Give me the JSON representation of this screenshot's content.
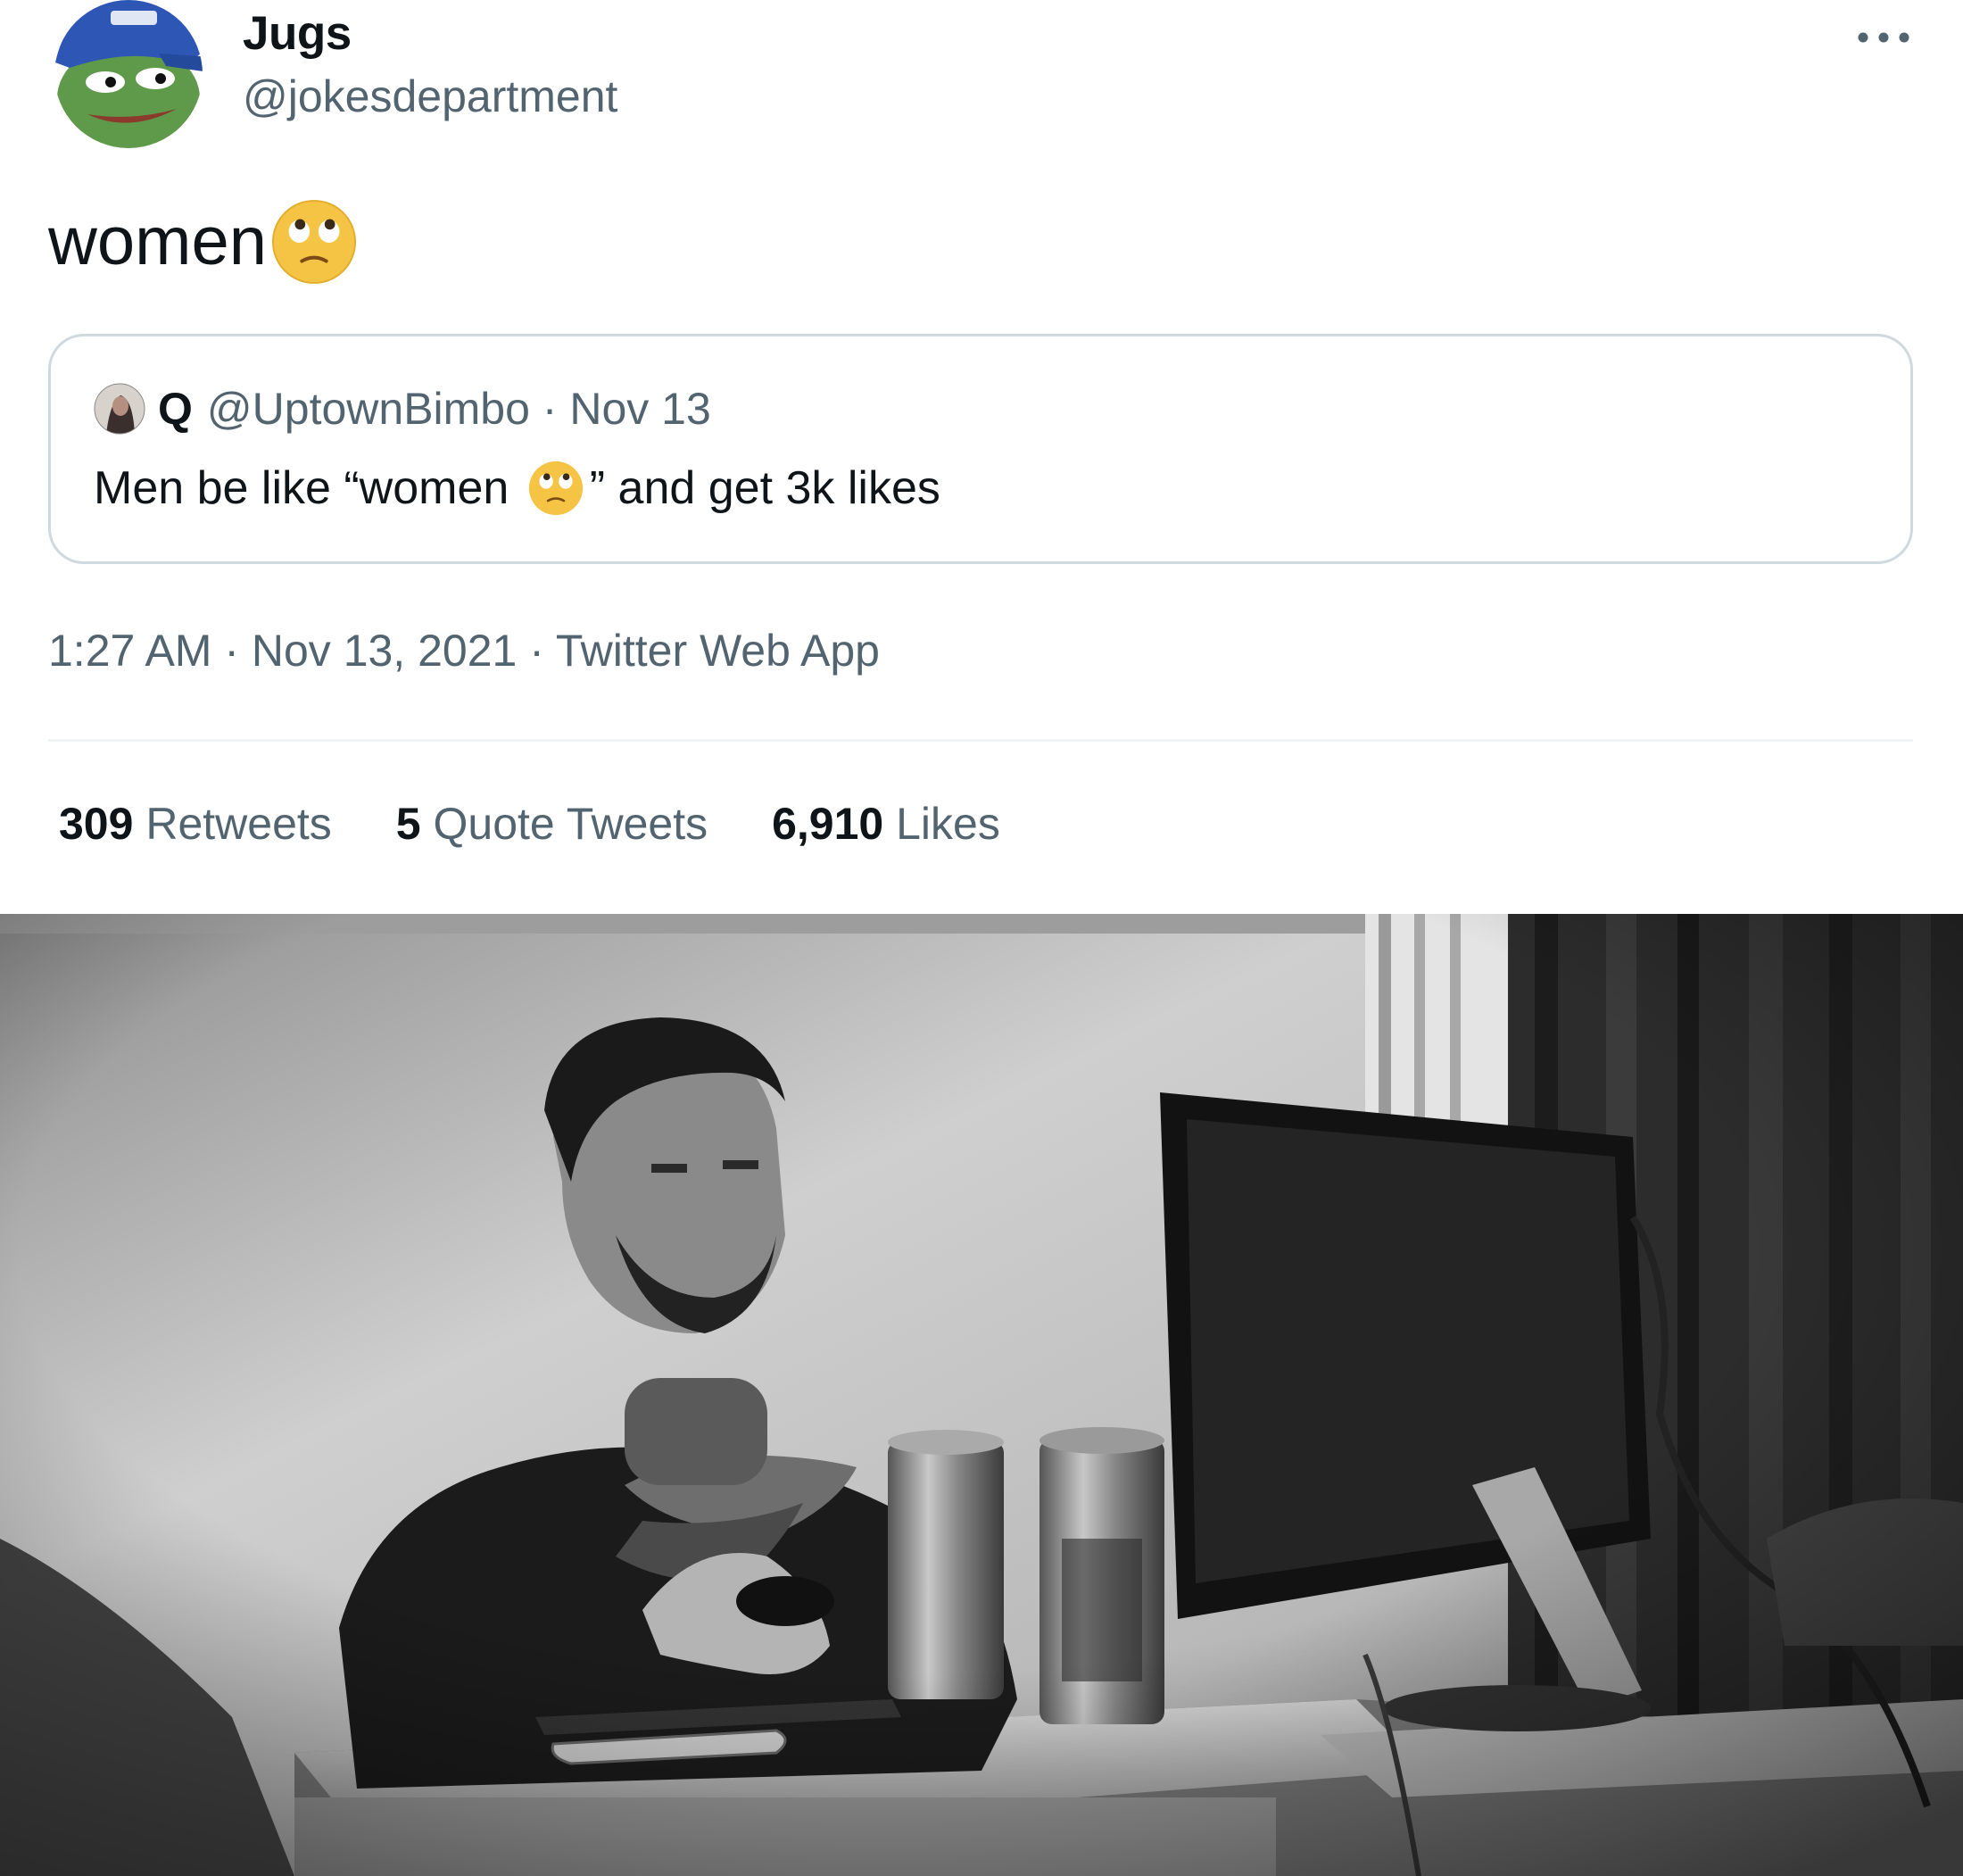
{
  "tweet": {
    "display_name": "Jugs",
    "handle": "@jokesdepartment",
    "text": "women",
    "text_emoji": "face-with-rolling-eyes",
    "quote": {
      "name": "Q",
      "handle_date": "@UptownBimbo · Nov 13",
      "text_before": "Men be like “women ",
      "text_emoji": "face-with-rolling-eyes",
      "text_after": "” and get 3k likes"
    },
    "meta": "1:27 AM · Nov 13, 2021 · Twitter Web App",
    "stats": [
      {
        "value": "309",
        "label": "Retweets"
      },
      {
        "value": "5",
        "label": "Quote Tweets"
      },
      {
        "value": "6,910",
        "label": "Likes"
      }
    ],
    "more_icon": "more-horizontal-icon"
  },
  "photo": {
    "description_icon": "grayscale-photo",
    "tone": "black-and-white"
  },
  "colors": {
    "text_primary": "#0f1419",
    "text_secondary": "#536471",
    "border": "#cfd9de",
    "emoji_yellow": "#f5c445",
    "avatar_hat_blue": "#2e57b5",
    "avatar_frog_green": "#5e9a4a"
  }
}
